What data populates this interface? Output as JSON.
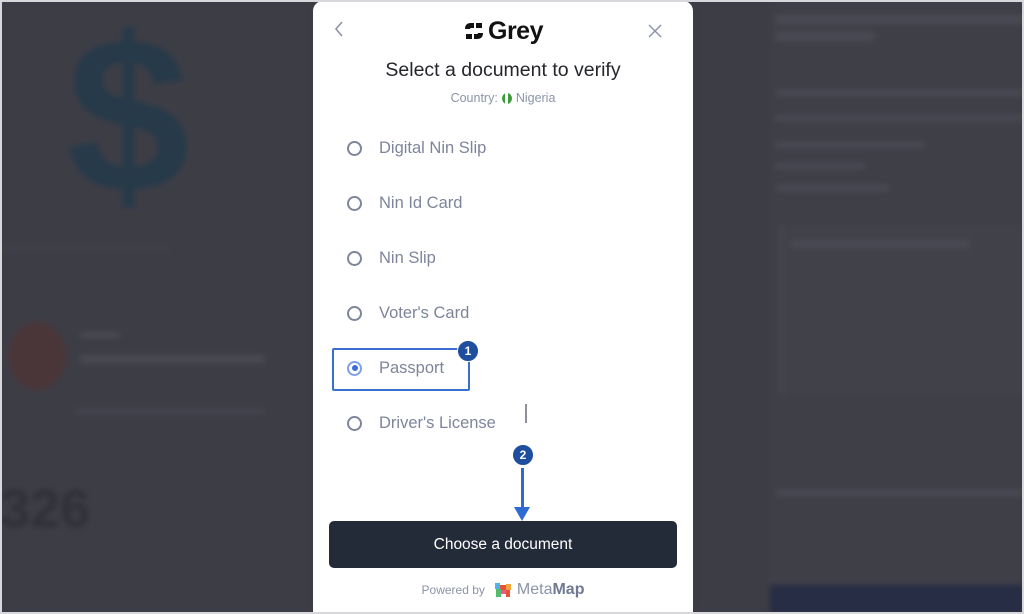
{
  "background": {
    "blurred_number": "326",
    "dollar_glyph": "$"
  },
  "modal": {
    "back_icon": "chevron-left-icon",
    "close_icon": "close-x-icon",
    "brand": {
      "name": "Grey",
      "logo_icon": "grey-logo-icon"
    },
    "title": "Select a document to verify",
    "country_label": "Country:",
    "country_value": "Nigeria",
    "country_flag": "nigeria-flag-icon",
    "options": [
      {
        "label": "Digital Nin Slip",
        "selected": false
      },
      {
        "label": "Nin Id Card",
        "selected": false
      },
      {
        "label": "Nin Slip",
        "selected": false
      },
      {
        "label": "Voter's Card",
        "selected": false
      },
      {
        "label": "Passport",
        "selected": true
      },
      {
        "label": "Driver's License",
        "selected": false
      }
    ],
    "annotations": {
      "step1": "1",
      "step2": "2"
    },
    "primary_button": "Choose a document",
    "footer": {
      "powered_by": "Powered by",
      "provider_light": "Meta",
      "provider_bold": "Map"
    }
  },
  "colors": {
    "button_bg": "#232a38",
    "accent": "#3a6ee0",
    "annotation": "#1e4f9e",
    "muted_text": "#7e859b"
  }
}
